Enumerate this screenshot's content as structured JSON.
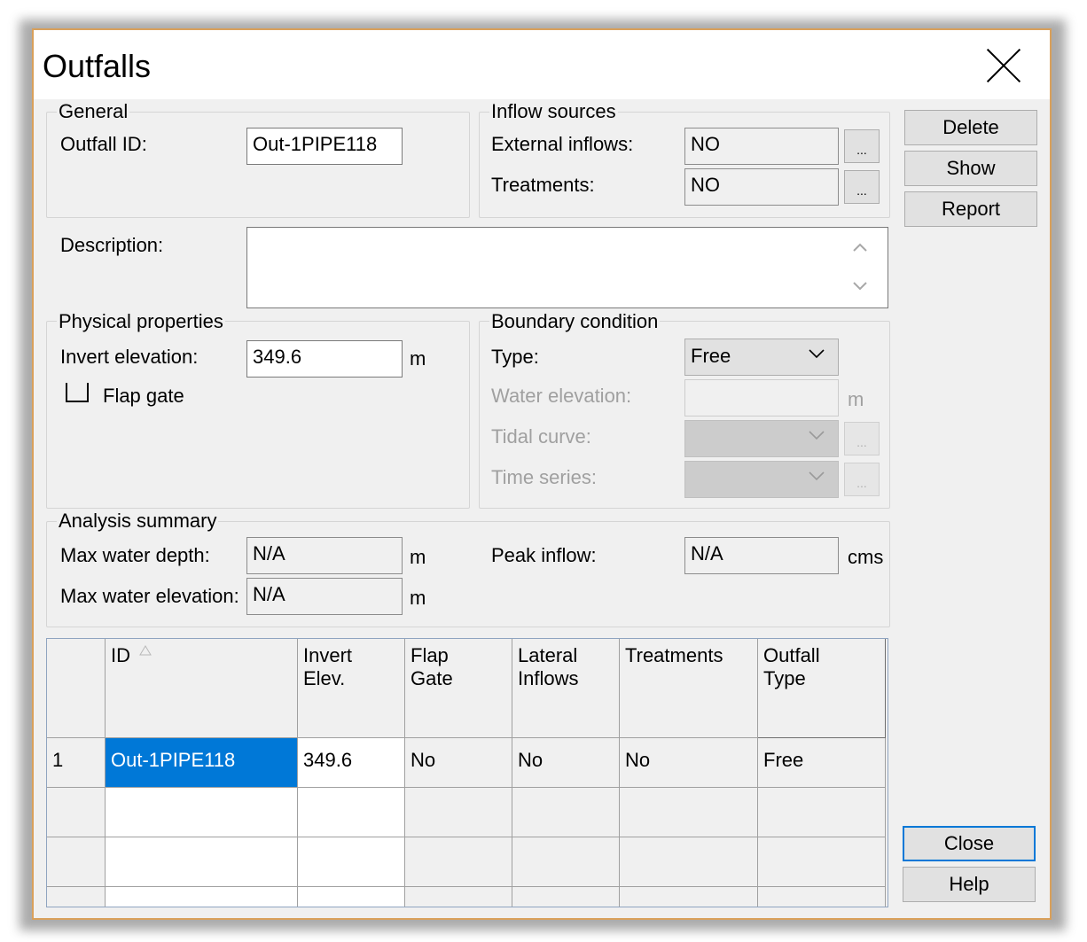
{
  "window": {
    "title": "Outfalls"
  },
  "general": {
    "group_title": "General",
    "outfall_id_label": "Outfall ID:",
    "outfall_id_value": "Out-1PIPE118"
  },
  "inflow_sources": {
    "group_title": "Inflow sources",
    "external_inflows_label": "External inflows:",
    "external_inflows_value": "NO",
    "treatments_label": "Treatments:",
    "treatments_value": "NO",
    "ellipsis": "..."
  },
  "buttons": {
    "delete": "Delete",
    "show": "Show",
    "report": "Report",
    "close": "Close",
    "help": "Help"
  },
  "description": {
    "label": "Description:",
    "value": ""
  },
  "physical": {
    "group_title": "Physical properties",
    "invert_label": "Invert elevation:",
    "invert_value": "349.6",
    "invert_unit": "m",
    "flap_gate_label": "Flap gate",
    "flap_gate_checked": false
  },
  "boundary": {
    "group_title": "Boundary condition",
    "type_label": "Type:",
    "type_value": "Free",
    "water_elev_label": "Water elevation:",
    "water_elev_unit": "m",
    "tidal_label": "Tidal curve:",
    "timeseries_label": "Time series:"
  },
  "analysis": {
    "group_title": "Analysis summary",
    "max_depth_label": "Max water depth:",
    "max_depth_value": "N/A",
    "max_depth_unit": "m",
    "max_elev_label": "Max water elevation:",
    "max_elev_value": "N/A",
    "max_elev_unit": "m",
    "peak_label": "Peak inflow:",
    "peak_value": "N/A",
    "peak_unit": "cms"
  },
  "table": {
    "headers": {
      "id": "ID",
      "invert_1": "Invert",
      "invert_2": "Elev.",
      "flap_1": "Flap",
      "flap_2": "Gate",
      "lateral_1": "Lateral",
      "lateral_2": "Inflows",
      "treatments": "Treatments",
      "type_1": "Outfall",
      "type_2": "Type"
    },
    "rows": [
      {
        "num": "1",
        "id": "Out-1PIPE118",
        "invert": "349.6",
        "flap": "No",
        "lateral": "No",
        "treatments": "No",
        "type": "Free"
      }
    ]
  }
}
